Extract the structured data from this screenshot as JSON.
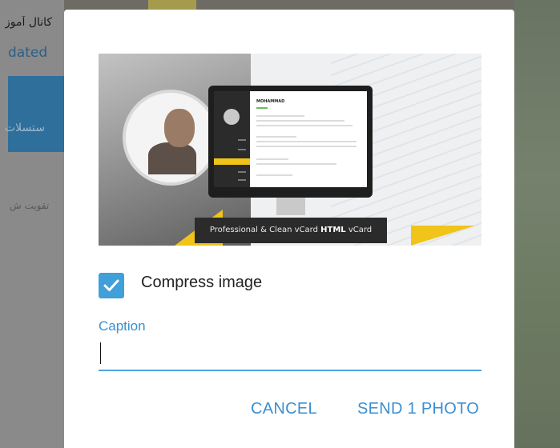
{
  "background": {
    "channel_title": "کانال آموز",
    "channel_status": "dated",
    "blue_item_text": "ستسلات",
    "gray_item_text": "تقویت ش"
  },
  "dialog": {
    "preview": {
      "banner_text_prefix": "Professional & Clean vCard ",
      "banner_text_bold": "HTML",
      "banner_text_suffix": " vCard",
      "screen_heading": "MOHAMMAD"
    },
    "compress": {
      "checked": true,
      "label": "Compress image"
    },
    "caption": {
      "label": "Caption",
      "value": "",
      "placeholder": ""
    },
    "buttons": {
      "cancel": "CANCEL",
      "send": "SEND 1 PHOTO"
    }
  },
  "colors": {
    "accent": "#419fd9",
    "accent_text": "#3a8fd0",
    "dialog_bg": "#ffffff"
  }
}
